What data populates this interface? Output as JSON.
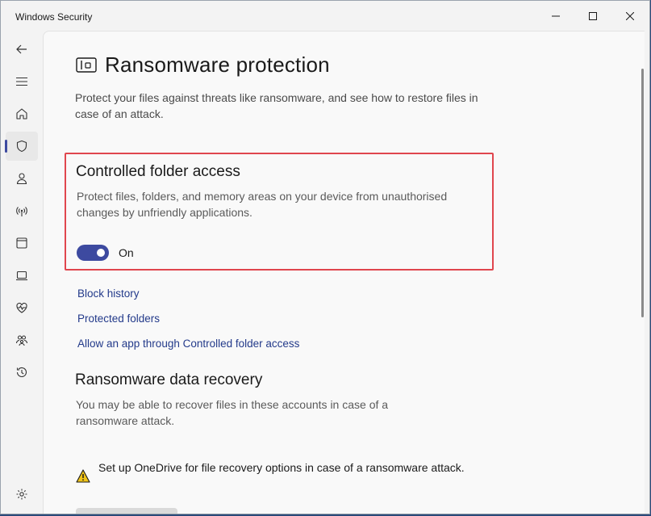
{
  "window": {
    "title": "Windows Security"
  },
  "sidebar": {
    "items": [
      {
        "icon": "back-arrow-icon"
      },
      {
        "icon": "hamburger-menu-icon"
      },
      {
        "icon": "home-icon"
      },
      {
        "icon": "shield-icon",
        "active": true
      },
      {
        "icon": "person-icon"
      },
      {
        "icon": "wifi-antenna-icon"
      },
      {
        "icon": "app-browser-icon"
      },
      {
        "icon": "laptop-icon"
      },
      {
        "icon": "heart-pulse-icon"
      },
      {
        "icon": "family-icon"
      },
      {
        "icon": "history-icon"
      },
      {
        "icon": "gear-icon"
      }
    ],
    "accent_color": "#3d4aa0"
  },
  "page": {
    "title": "Ransomware protection",
    "description": "Protect your files against threats like ransomware, and see how to restore files in case of an attack."
  },
  "controlled_folder_access": {
    "title": "Controlled folder access",
    "description": "Protect files, folders, and memory areas on your device from unauthorised changes by unfriendly applications.",
    "toggle_state": "On",
    "toggle_on": true,
    "highlight_color": "#e0464e"
  },
  "links": {
    "block_history": "Block history",
    "protected_folders": "Protected folders",
    "allow_app": "Allow an app through Controlled folder access"
  },
  "recovery": {
    "title": "Ransomware data recovery",
    "description": "You may be able to recover files in these accounts in case of a ransomware attack.",
    "warning": "Set up OneDrive for file recovery options in case of a ransomware attack."
  }
}
